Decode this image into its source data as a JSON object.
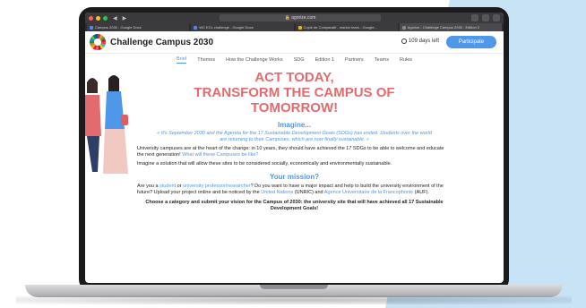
{
  "browser": {
    "url": "agorize.com",
    "tabs": [
      {
        "label": "Campus 2030 - Google Docs",
        "color": "#4f86f7"
      },
      {
        "label": "WC ECL challenge - Google Docs",
        "color": "#4f86f7"
      },
      {
        "label": "Copie de Comparatif - market team - Google...",
        "color": "#f4b400"
      },
      {
        "label": "Agorize - Challenge Campus 2030 - Edition 2",
        "color": "#888888"
      }
    ]
  },
  "header": {
    "title": "Challenge Campus 2030",
    "days_left": "109 days left",
    "participate_label": "Participate"
  },
  "subnav": {
    "items": [
      "Brief",
      "Themes",
      "How the Challenge Works",
      "SDG",
      "Edition 1",
      "Partners",
      "Teams",
      "Rules"
    ],
    "active": "Brief"
  },
  "content": {
    "hero_line1": "ACT TODAY,",
    "hero_line2": "TRANSFORM THE CAMPUS OF",
    "hero_line3": "TOMORROW!",
    "imagine_heading": "Imagine...",
    "quote": "« It's September 2030 and the Agenda for the 17 Sustainable Development Goals (SDGs) has ended. Students over the world are returning to their Campuses, which are now finally sustainable. »",
    "para1_text": "University campuses are at the heart of the change: in 10 years, they should have achieved the 17 SDGs to be able to welcome and educate the next generation!",
    "para1_link": "What will these Campuses be like?",
    "para2": "Imagine a solution that will allow these sites to be considered socially, economically and environmentally sustainable.",
    "mission_heading": "Your mission?",
    "mission_a": "Are you a",
    "mission_link1": "student",
    "mission_b": "or",
    "mission_link2": "university professor/researcher",
    "mission_c": "? Do you want to have a major impact and help to build the university environment of the future? Upload your project online and be noticed by the",
    "mission_link3": "United Nations",
    "mission_d": "(UNRIC) and",
    "mission_link4": "Agence Universitaire de la Francophonie",
    "mission_e": "(AUF).",
    "choose": "Choose a category and submit your vision for the Campus of 2030: the university site that will have achieved all 17 Sustainable Development Goals!"
  },
  "colors": {
    "accent_blue": "#4f97e8",
    "hero_red": "#e36b6e",
    "background_blue": "#c9e3f6"
  }
}
